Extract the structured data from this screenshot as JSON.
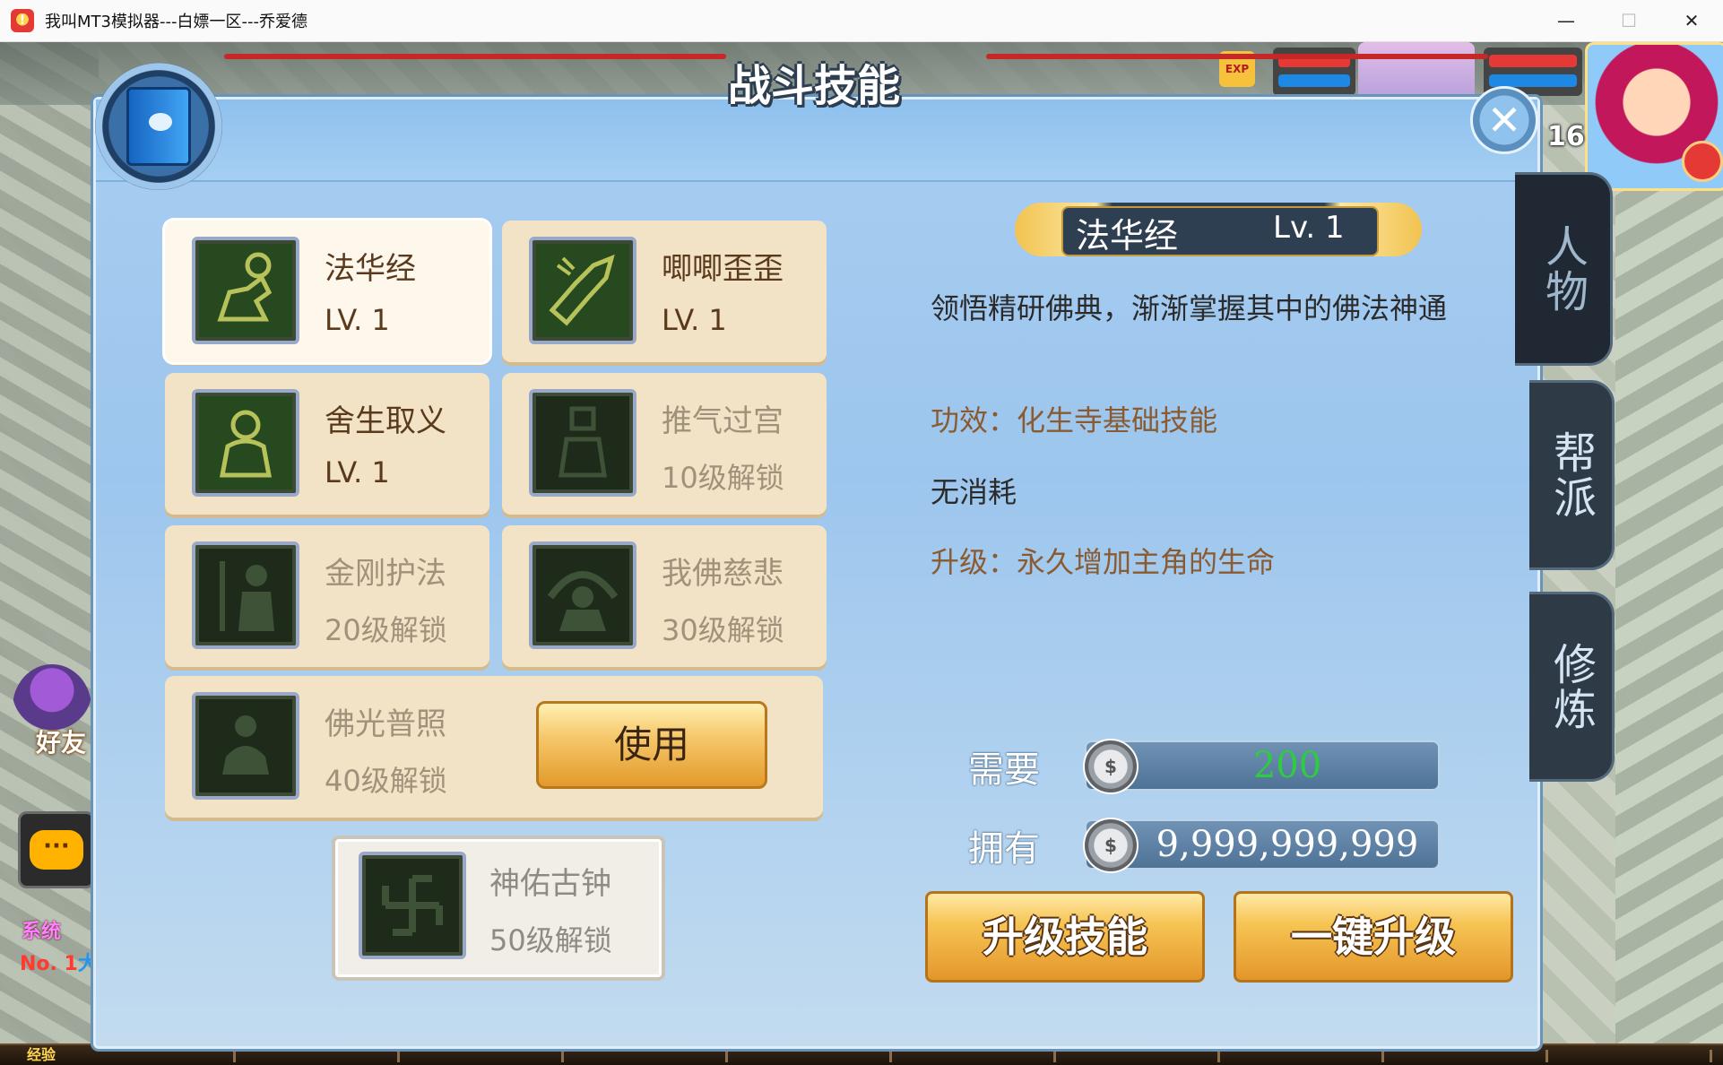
{
  "window": {
    "title": "我叫MT3模拟器---白嫖一区---乔爱德",
    "minimize_glyph": "—",
    "maximize_glyph": "☐",
    "close_glyph": "✕"
  },
  "hud": {
    "exp_label": "经验",
    "player_level": "16",
    "friend_label": "好友",
    "system_label": "系统",
    "rank_prefix": "No. 1",
    "rank_suffix": "大"
  },
  "panel": {
    "title": "战斗技能",
    "close_icon": "close-icon"
  },
  "skills": [
    {
      "name": "法华经",
      "sub": "LV. 1",
      "locked": false,
      "selected": true,
      "icon": "meditating-figure-icon"
    },
    {
      "name": "唧唧歪歪",
      "sub": "LV. 1",
      "locked": false,
      "selected": false,
      "icon": "beast-claw-icon"
    },
    {
      "name": "舍生取义",
      "sub": "LV. 1",
      "locked": false,
      "selected": false,
      "icon": "monk-silhouette-icon"
    },
    {
      "name": "推气过宫",
      "sub": "10级解锁",
      "locked": true,
      "selected": false,
      "icon": "pose-figure-icon"
    },
    {
      "name": "金刚护法",
      "sub": "20级解锁",
      "locked": true,
      "selected": false,
      "icon": "guardian-staff-icon"
    },
    {
      "name": "我佛慈悲",
      "sub": "30级解锁",
      "locked": true,
      "selected": false,
      "icon": "buddha-halo-icon"
    },
    {
      "name": "佛光普照",
      "sub": "40级解锁",
      "locked": true,
      "selected": false,
      "icon": "buddha-seated-icon"
    }
  ],
  "use_button": "使用",
  "bonus_skill": {
    "name": "神佑古钟",
    "sub": "50级解锁",
    "icon": "swastika-icon"
  },
  "detail": {
    "name": "法华经",
    "level": "Lv. 1",
    "description": "领悟精研佛典，渐渐掌握其中的佛法神通",
    "effect": "功效：化生寺基础技能",
    "cost": "无消耗",
    "upgrade": "升级：永久增加主角的生命",
    "need_label": "需要",
    "need_value": "200",
    "have_label": "拥有",
    "have_value": "9,999,999,999",
    "coin_icon": "silver-coin-icon",
    "upgrade_button": "升级技能",
    "oneclick_button": "一键升级"
  },
  "side_tabs": [
    {
      "label": "人物",
      "active": true
    },
    {
      "label": "帮派",
      "active": false
    },
    {
      "label": "修炼",
      "active": false
    }
  ],
  "colors": {
    "panel_bg": "#a7cdf0",
    "card_bg": "#f3e3c6",
    "button_gold": "#f6c453",
    "locked_text": "#a0917b",
    "need_value_green": "#2ecc40"
  }
}
